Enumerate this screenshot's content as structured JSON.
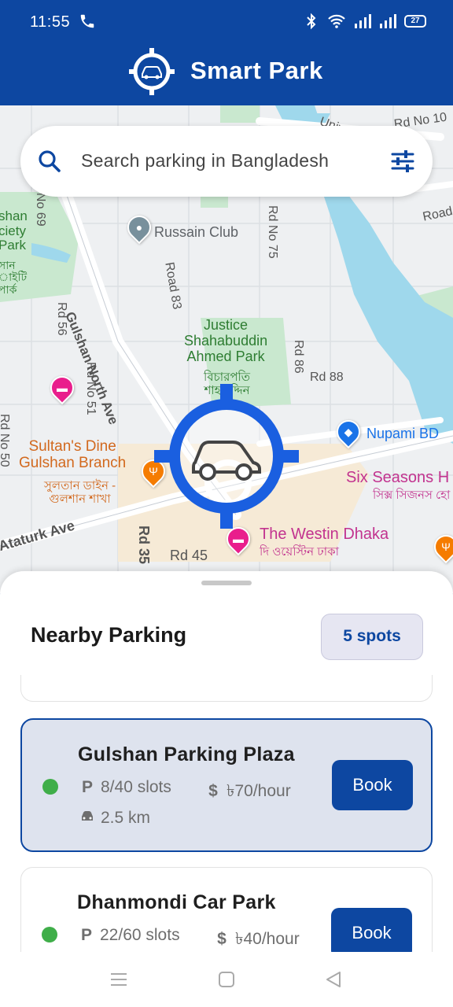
{
  "status_bar": {
    "time": "11:55",
    "battery": "27"
  },
  "app": {
    "title": "Smart Park"
  },
  "search": {
    "placeholder": "Search parking in Bangladesh"
  },
  "map_labels": {
    "russain_club": "Russain Club",
    "gulshan_north_ave": "Gulshan North Ave",
    "road_83": "Road 83",
    "rd_no_75": "Rd No 75",
    "rd_no_69": "Rd No 69",
    "rd_56": "Rd 56",
    "rd_no_51": "Rd No 51",
    "rd_no_50": "Rd No 50",
    "rd_86": "Rd 86",
    "rd_88": "Rd 88",
    "rd_35": "Rd 35",
    "rd_45": "Rd 45",
    "ataturk_ave": "Ataturk Ave",
    "road_right": "Road",
    "rd_no_10": "Rd No 10",
    "univ": "Univ",
    "justice_park_en": "Justice\nShahabuddin\nAhmed Park",
    "justice_park_bn": "বিচারপতি\nশাহাবুদ্দিন",
    "gulshan_park_en": "shan\nciety\nPark",
    "gulshan_park_bn": "সান\nাইটি\nপার্ক",
    "sultans_dine_en": "Sultan's Dine\nGulshan Branch",
    "sultans_dine_bn": "সুলতান ডাইন -\nগুলশান শাখা",
    "nupami": "Nupami BD",
    "six_seasons_en": "Six Seasons H",
    "six_seasons_bn": "সিক্স সিজনস হো",
    "westin_en": "The Westin Dhaka",
    "westin_bn": "দি ওয়েস্টিন ঢাকা"
  },
  "nearby": {
    "title": "Nearby Parking",
    "count_label": "5 spots"
  },
  "parking_list": [
    {
      "name": "Gulshan Parking Plaza",
      "slots": "8/40 slots",
      "price": "৳70/hour",
      "distance": "2.5 km",
      "status_color": "#3fae49",
      "selected": true,
      "book_label": "Book"
    },
    {
      "name": "Dhanmondi Car Park",
      "slots": "22/60 slots",
      "price": "৳40/hour",
      "status_color": "#3fae49",
      "selected": false,
      "book_label": "Book"
    }
  ],
  "icons": {
    "parking": "P",
    "price": "$"
  },
  "colors": {
    "primary": "#0d47a1",
    "available": "#3fae49",
    "selected_card_bg": "#dee3ee"
  }
}
